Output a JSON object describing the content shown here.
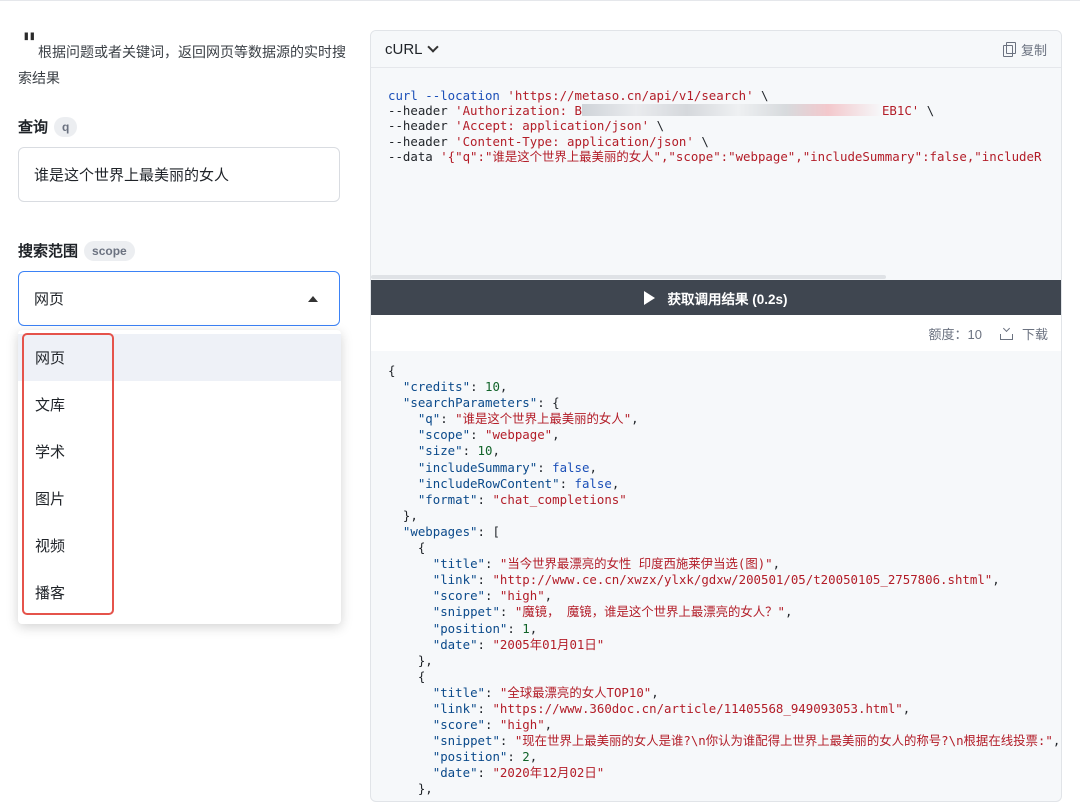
{
  "form": {
    "description": "根据问题或者关键词，返回网页等数据源的实时搜索结果",
    "query": {
      "label": "查询",
      "tag": "q",
      "value": "谁是这个世界上最美丽的女人"
    },
    "scope": {
      "label": "搜索范围",
      "tag": "scope",
      "selected": "网页",
      "options": [
        "网页",
        "文库",
        "学术",
        "图片",
        "视频",
        "播客"
      ]
    }
  },
  "code_panel": {
    "language": "cURL",
    "copy_label": "复制",
    "request_lines": [
      "curl --location 'https://metaso.cn/api/v1/search' \\",
      "--header 'Authorization: B",
      "EB1C' \\",
      "--header 'Accept: application/json' \\",
      "--header 'Content-Type: application/json' \\",
      "--data '{\"q\":\"谁是这个世界上最美丽的女人\",\"scope\":\"webpage\",\"includeSummary\":false,\"includeR"
    ],
    "run_label": "获取调用结果 (0.2s)",
    "credits_label": "额度：10",
    "download_label": "下载",
    "response": {
      "credits": 10,
      "searchParameters": {
        "q": "谁是这个世界上最美丽的女人",
        "scope": "webpage",
        "size": 10,
        "includeSummary": false,
        "includeRowContent": false,
        "format": "chat_completions"
      },
      "webpages": [
        {
          "title": "当今世界最漂亮的女性 印度西施莱伊当选(图)",
          "link": "http://www.ce.cn/xwzx/ylxk/gdxw/200501/05/t20050105_2757806.shtml",
          "score": "high",
          "snippet": "魔镜， 魔镜，谁是这个世界上最漂亮的女人？",
          "position": 1,
          "date": "2005年01月01日"
        },
        {
          "title": "全球最漂亮的女人TOP10",
          "link": "https://www.360doc.cn/article/11405568_949093053.html",
          "score": "high",
          "snippet": "现在世界上最美丽的女人是谁?\\n你认为谁配得上世界上最美丽的女人的称号?\\n根据在线投票:",
          "position": 2,
          "date": "2020年12月02日"
        }
      ]
    }
  }
}
